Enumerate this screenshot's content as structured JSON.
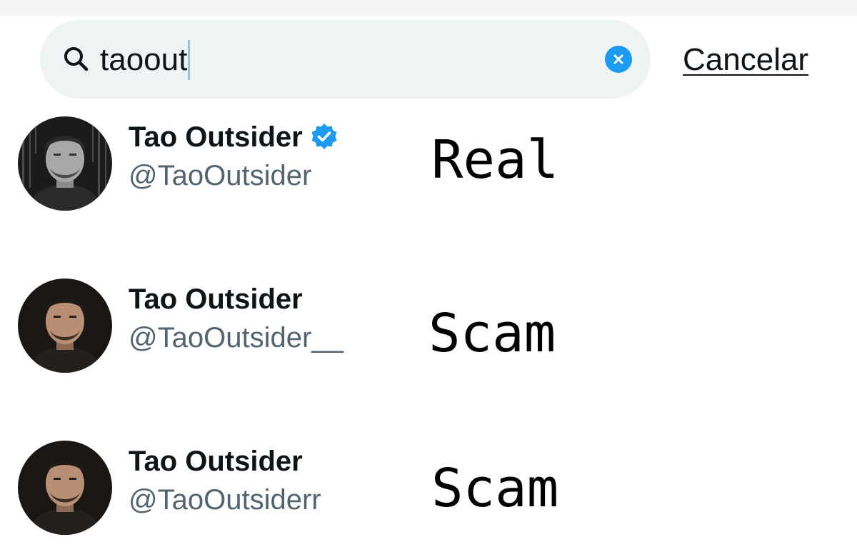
{
  "search": {
    "query": "taoout",
    "cancel_label": "Cancelar",
    "icons": {
      "search": "search-icon",
      "clear": "clear-icon"
    }
  },
  "results": [
    {
      "name": "Tao Outsider",
      "handle": "@TaoOutsider",
      "verified": true,
      "annotation": "Real"
    },
    {
      "name": "Tao Outsider",
      "handle": "@TaoOutsider__",
      "verified": false,
      "annotation": "Scam"
    },
    {
      "name": "Tao Outsider",
      "handle": "@TaoOutsiderr",
      "verified": false,
      "annotation": "Scam"
    }
  ],
  "colors": {
    "accent": "#1d9bf0",
    "text_primary": "#0f1419",
    "text_secondary": "#536471",
    "search_bg": "#eef3f4"
  }
}
